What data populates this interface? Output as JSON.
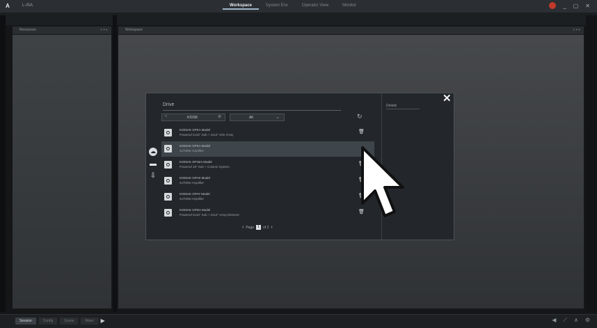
{
  "titlebar": {
    "logo": "A",
    "app_name": "L-ISA",
    "tabs": [
      {
        "label": "Workspace",
        "active": true
      },
      {
        "label": "System Env",
        "active": false
      },
      {
        "label": "Operator View",
        "active": false
      },
      {
        "label": "Monitor",
        "active": false
      }
    ],
    "minimize": "_",
    "maximize": "▢",
    "close": "✕"
  },
  "left_panel": {
    "title": "Resources",
    "controls": "⌕  ▾  ◂"
  },
  "main_panel": {
    "title": "Workspace",
    "controls": "⌕  ▾  ◂"
  },
  "dialog": {
    "close": "✕",
    "drive_title": "Drive",
    "search_value": "KIOSK",
    "filter_value": "All",
    "details_title": "Details",
    "rows": [
      {
        "line1": "KODIAK GPKA Model",
        "line2": "Powered 2x15\" Sub + 4x12\" Dim Array",
        "highlight": false
      },
      {
        "line1": "KODIAK GPKA Model",
        "line2": "4x700W Amplifier",
        "highlight": true
      },
      {
        "line1": "KODIAK SP15m Model",
        "line2": "Powered 18\" Sub + Column System",
        "highlight": false
      },
      {
        "line1": "KODIAK GPAS Model",
        "line2": "4x700W Amplifier",
        "highlight": false
      },
      {
        "line1": "KODIAK GPAY Model",
        "line2": "4x700W Amplifier",
        "highlight": false
      },
      {
        "line1": "KODIAK GPDA Model",
        "line2": "Powered 2x18\" Sub + 2x12\" Array Element",
        "highlight": false
      }
    ],
    "pager": {
      "label": "Page",
      "current": "1",
      "of": "of 2"
    }
  },
  "bottombar": {
    "tabs": [
      {
        "label": "Session",
        "active": true
      },
      {
        "label": "Config",
        "active": false
      },
      {
        "label": "Scene",
        "active": false
      },
      {
        "label": "Mixer",
        "active": false
      }
    ]
  }
}
